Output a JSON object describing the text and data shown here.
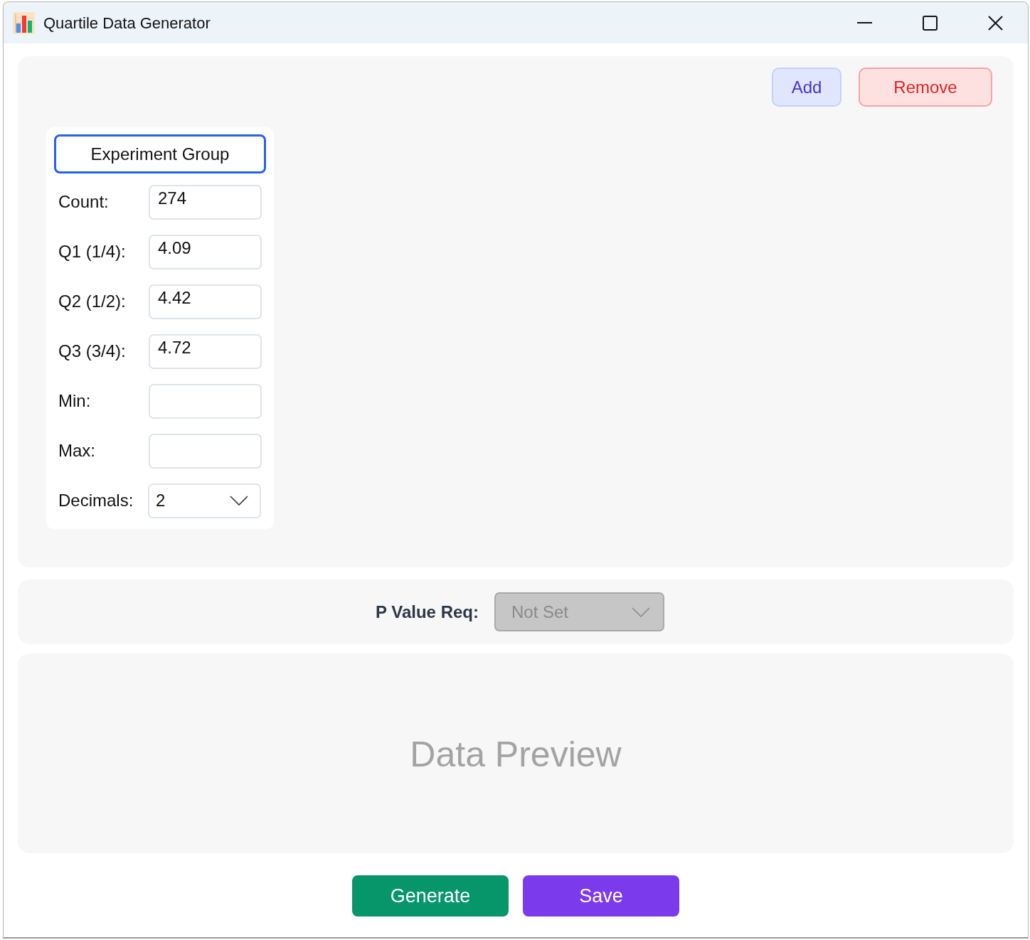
{
  "window": {
    "title": "Quartile Data Generator"
  },
  "toolbar": {
    "buttons": [
      {
        "label": "Add",
        "kind": "add"
      },
      {
        "label": "Remove",
        "kind": "remove"
      }
    ]
  },
  "groups": [
    {
      "name": "Experiment Group",
      "focused": true,
      "fields": [
        {
          "label": "Count:",
          "value": "274",
          "kind": "text"
        },
        {
          "label": "Q1 (1/4):",
          "value": "4.09",
          "kind": "text"
        },
        {
          "label": "Q2 (1/2):",
          "value": "4.42",
          "kind": "text"
        },
        {
          "label": "Q3 (3/4):",
          "value": "4.72",
          "kind": "text"
        },
        {
          "label": "Min:",
          "kind": "text"
        },
        {
          "label": "Max:",
          "kind": "text"
        },
        {
          "label": "Decimals:",
          "value": "2",
          "kind": "select"
        }
      ]
    }
  ],
  "p_value": {
    "label": "P Value Req:",
    "value": "Not Set",
    "disabled": true
  },
  "preview": {
    "placeholder": "Data Preview"
  },
  "actions": [
    {
      "label": "Generate",
      "kind": "generate"
    },
    {
      "label": "Save",
      "kind": "save"
    }
  ]
}
